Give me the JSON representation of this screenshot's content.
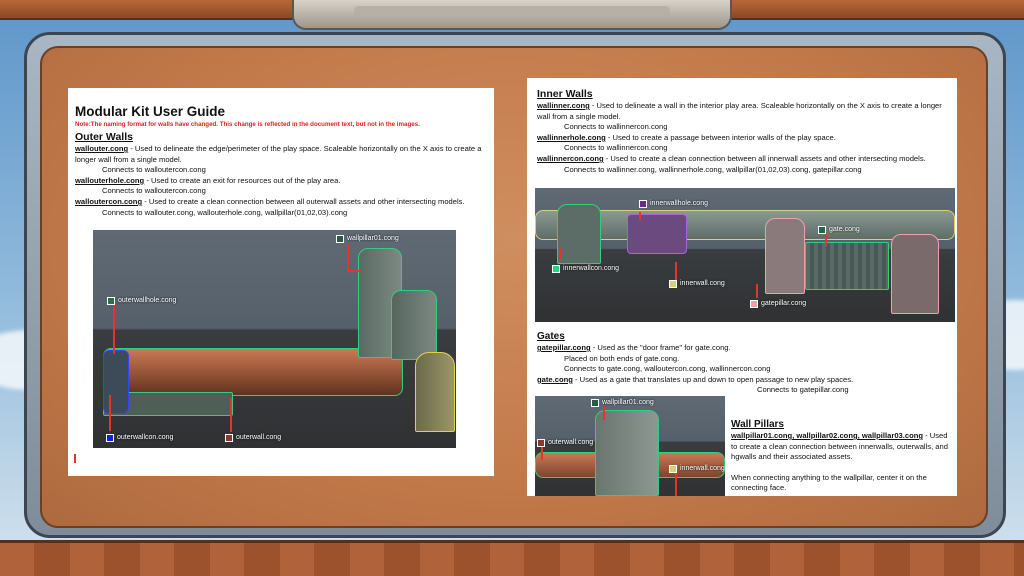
{
  "left_page": {
    "title": "Modular Kit User Guide",
    "note": "Note:The naming format for walls have changed. This change is reflected in the document text, but not in the images.",
    "section_title": "Outer Walls",
    "items": [
      {
        "term": "wallouter.cong",
        "desc": " - Used to delineate the edge/perimeter of the play space. Scaleable horizontally on the X axis to create a longer wall from a single model.",
        "connects": "Connects to walloutercon.cong"
      },
      {
        "term": "wallouterhole.cong",
        "desc": " - Used to create an exit for resources out of the play area.",
        "connects": "Connects to walloutercon.cong"
      },
      {
        "term": "walloutercon.cong",
        "desc": " - Used to create a clean connection between all outerwall assets and other intersecting models.",
        "connects": "Connects to wallouter.cong, wallouterhole.cong, wallpillar(01,02,03).cong"
      }
    ],
    "labels": {
      "pillar": "wallpillar01.cong",
      "hole": "outerwallhole.cong",
      "con": "outerwallcon.cong",
      "wall": "outerwall.cong"
    }
  },
  "right_page": {
    "inner_title": "Inner Walls",
    "inner_items": [
      {
        "term": "wallinner.cong",
        "desc": " - Used to delineate a wall in the interior play area. Scaleable horizontally on the X axis to create a longer wall from a single model.",
        "connects": "Connects to wallinnercon.cong"
      },
      {
        "term": "wallinnerhole.cong",
        "desc": " - Used to create a passage between interior walls of the play space.",
        "connects": "Connects to wallinnercon.cong"
      },
      {
        "term": "wallinnercon.cong",
        "desc": " - Used to create a clean connection between all innerwall assets and other intersecting models.",
        "connects": "Connects to wallinner.cong, wallinnerhole.cong, wallpillar(01,02,03).cong, gatepillar.cong"
      }
    ],
    "inner_labels": {
      "hole": "innerwallhole.cong",
      "gate": "gate.cong",
      "con": "innerwallcon.cong",
      "wall": "innerwall.cong",
      "gatepillar": "gatepillar.cong"
    },
    "gates_title": "Gates",
    "gatepillar_term": "gatepillar.cong",
    "gatepillar_desc": " - Used as the \"door frame\" for gate.cong.",
    "gatepillar_placed": "Placed on both ends of gate.cong.",
    "gatepillar_connects": "Connects to gate.cong, walloutercon.cong, wallinnercon.cong",
    "gate_term": "gate.cong",
    "gate_desc": " - Used as a gate that translates up and down to open passage to new play spaces.",
    "gate_connects": "Connects to gatepillar.cong",
    "pillar_labels": {
      "pillar": "wallpillar01.cong",
      "outer": "outerwall.cong",
      "inner": "innerwall.cong"
    },
    "pillars_title": "Wall Pillars",
    "pillars_terms": "wallpillar01.cong, wallpillar02.cong, wallpillar03.cong",
    "pillars_desc": " - Used to create a clean connection between innerwalls, outerwalls, and hgwalls and their associated assets.",
    "pillars_note": "When connecting anything to the wallpillar, center it on the connecting face."
  },
  "colors": {
    "pillar": "#2e5a45",
    "hole_outer": "#2f6b4c",
    "con_outer": "#1020e0",
    "wall_outer": "#8a3a2a",
    "hole_inner": "#6a2a8a",
    "gate": "#1e6a4a",
    "con_inner": "#30d080",
    "wall_inner": "#d8d078",
    "gatepillar": "#f2a0a8",
    "pin": "#e8332a"
  }
}
